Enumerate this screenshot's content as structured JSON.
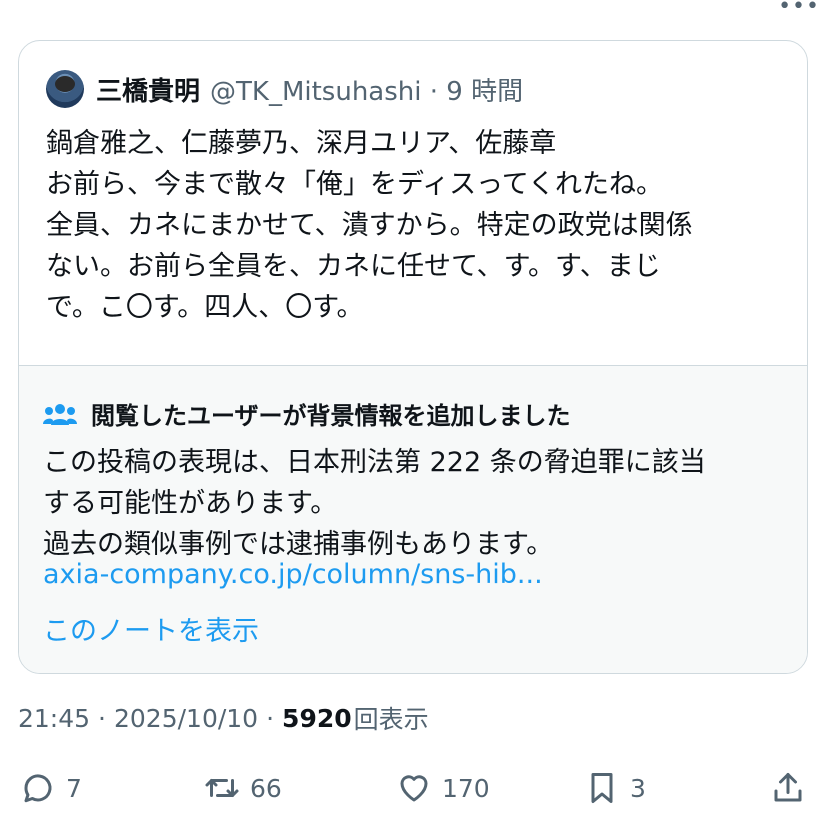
{
  "top": {
    "more_dots": "•••"
  },
  "quote": {
    "author_name": "三橋貴明",
    "author_handle": "@TK_Mitsuhashi · 9 時間",
    "text": "鍋倉雅之、仁藤夢乃、深月ユリア、佐藤章\nお前ら、今まで散々「俺」をディスってくれたね。\n全員、カネにまかせて、潰すから。特定の政党は関係\nない。お前ら全員を、カネに任せて、す。す、まじ\nで。こ〇す。四人、〇す。"
  },
  "note": {
    "title": "閲覧したユーザーが背景情報を追加しました",
    "body": "この投稿の表現は、日本刑法第 222 条の脅迫罪に該当\nする可能性があります。\n過去の類似事例では逮捕事例もあります。",
    "link": "axia-company.co.jp/column/sns-hib...",
    "show_label": "このノートを表示"
  },
  "meta": {
    "time": "21:45",
    "date": "2025/10/10",
    "views_count": "5920",
    "views_label": "回表示"
  },
  "actions": {
    "reply_count": "7",
    "repost_count": "66",
    "like_count": "170",
    "bookmark_count": "3"
  },
  "colors": {
    "accent": "#1d9bf0",
    "secondary_text": "#536471",
    "border": "#cfd9de",
    "note_bg": "#f7f9f9"
  }
}
